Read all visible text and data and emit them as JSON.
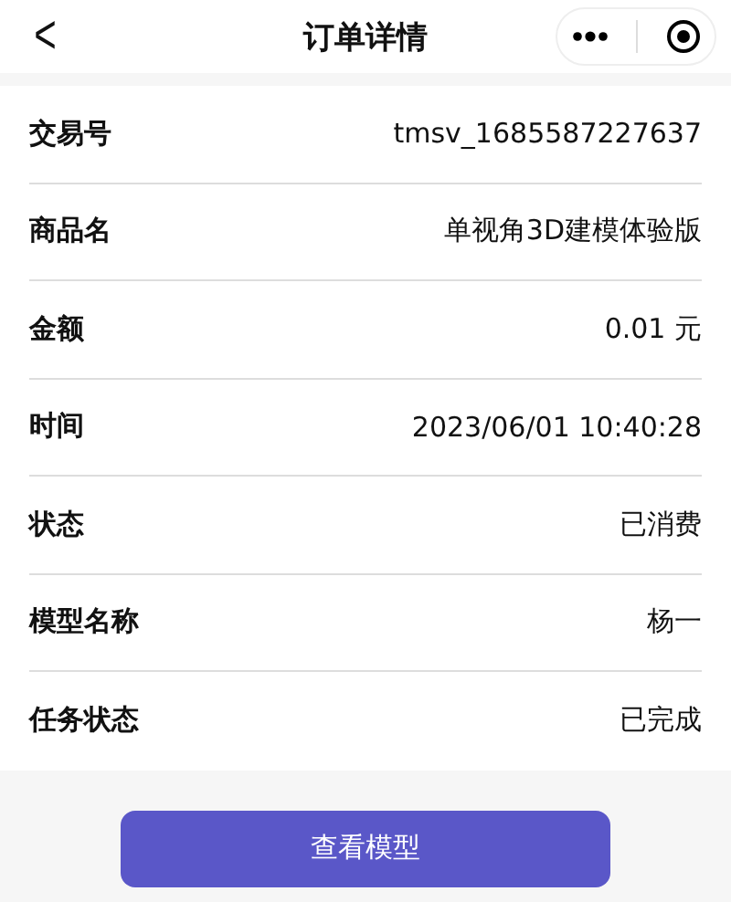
{
  "nav_bar": {
    "back": "<",
    "title": "订单详情"
  },
  "rows": [
    {
      "label": "交易号",
      "value": "tmsv_1685587227637"
    },
    {
      "label": "商品名",
      "value": "单视角3D建模体验版"
    },
    {
      "label": "金额",
      "value": "0.01 元"
    },
    {
      "label": "时间",
      "value": "2023/06/01 10:40:28"
    },
    {
      "label": "状态",
      "value": "已消费"
    },
    {
      "label": "模型名称",
      "value": "杨一"
    },
    {
      "label": "任务状态",
      "value": "已完成"
    }
  ],
  "action_button": "查看模型"
}
